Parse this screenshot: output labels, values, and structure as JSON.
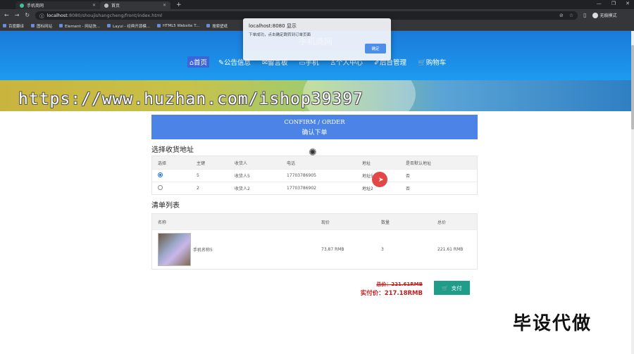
{
  "browser": {
    "tabs": [
      {
        "title": "手机商网",
        "active": false
      },
      {
        "title": "首页",
        "active": true
      }
    ],
    "new_tab": "+",
    "address": {
      "host": "localhost",
      "rest": ":8080/shoujishangcheng/front/index.html"
    },
    "profile": "无痕模式",
    "bookmarks": [
      "百度翻译",
      "图标网站",
      "Element - 网站快...",
      "Layui - 经典开源模...",
      "HTML5 Website T...",
      "搜索壁纸"
    ]
  },
  "site": {
    "title": "手机商网",
    "nav": [
      "⌂首页",
      "✎公告信息",
      "✉留言板",
      "▭手机",
      "♙个人中心",
      "✐后台管理",
      "🛒购物车"
    ]
  },
  "watermark": "https://www.huzhan.com/ishop39397",
  "confirm": {
    "en": "CONFIRM / ORDER",
    "zh": "确认下单"
  },
  "address_section": {
    "title": "选择收货地址",
    "headers": [
      "选择",
      "主键",
      "收货人",
      "电话",
      "地址",
      "是否默认地址"
    ],
    "rows": [
      {
        "selected": true,
        "id": "5",
        "name": "收货人5",
        "phone": "17703786905",
        "address": "地址5",
        "default": "否"
      },
      {
        "selected": false,
        "id": "2",
        "name": "收货人2",
        "phone": "17703786902",
        "address": "地址2",
        "default": "否"
      }
    ]
  },
  "cart_section": {
    "title": "清单列表",
    "headers": [
      "名称",
      "现价",
      "数量",
      "总价"
    ],
    "rows": [
      {
        "name": "手机名称5",
        "price": "73.87 RMB",
        "qty": "3",
        "total": "221.61 RMB"
      }
    ]
  },
  "totals": {
    "old": "总价：221.61RMB",
    "real": "实付价：217.18RMB"
  },
  "pay_label": "支付",
  "brand_mark": "毕设代做",
  "alert": {
    "title": "localhost:8080 显示",
    "message": "下单成功，点击确定跳转到订单页面",
    "ok": "确定"
  }
}
